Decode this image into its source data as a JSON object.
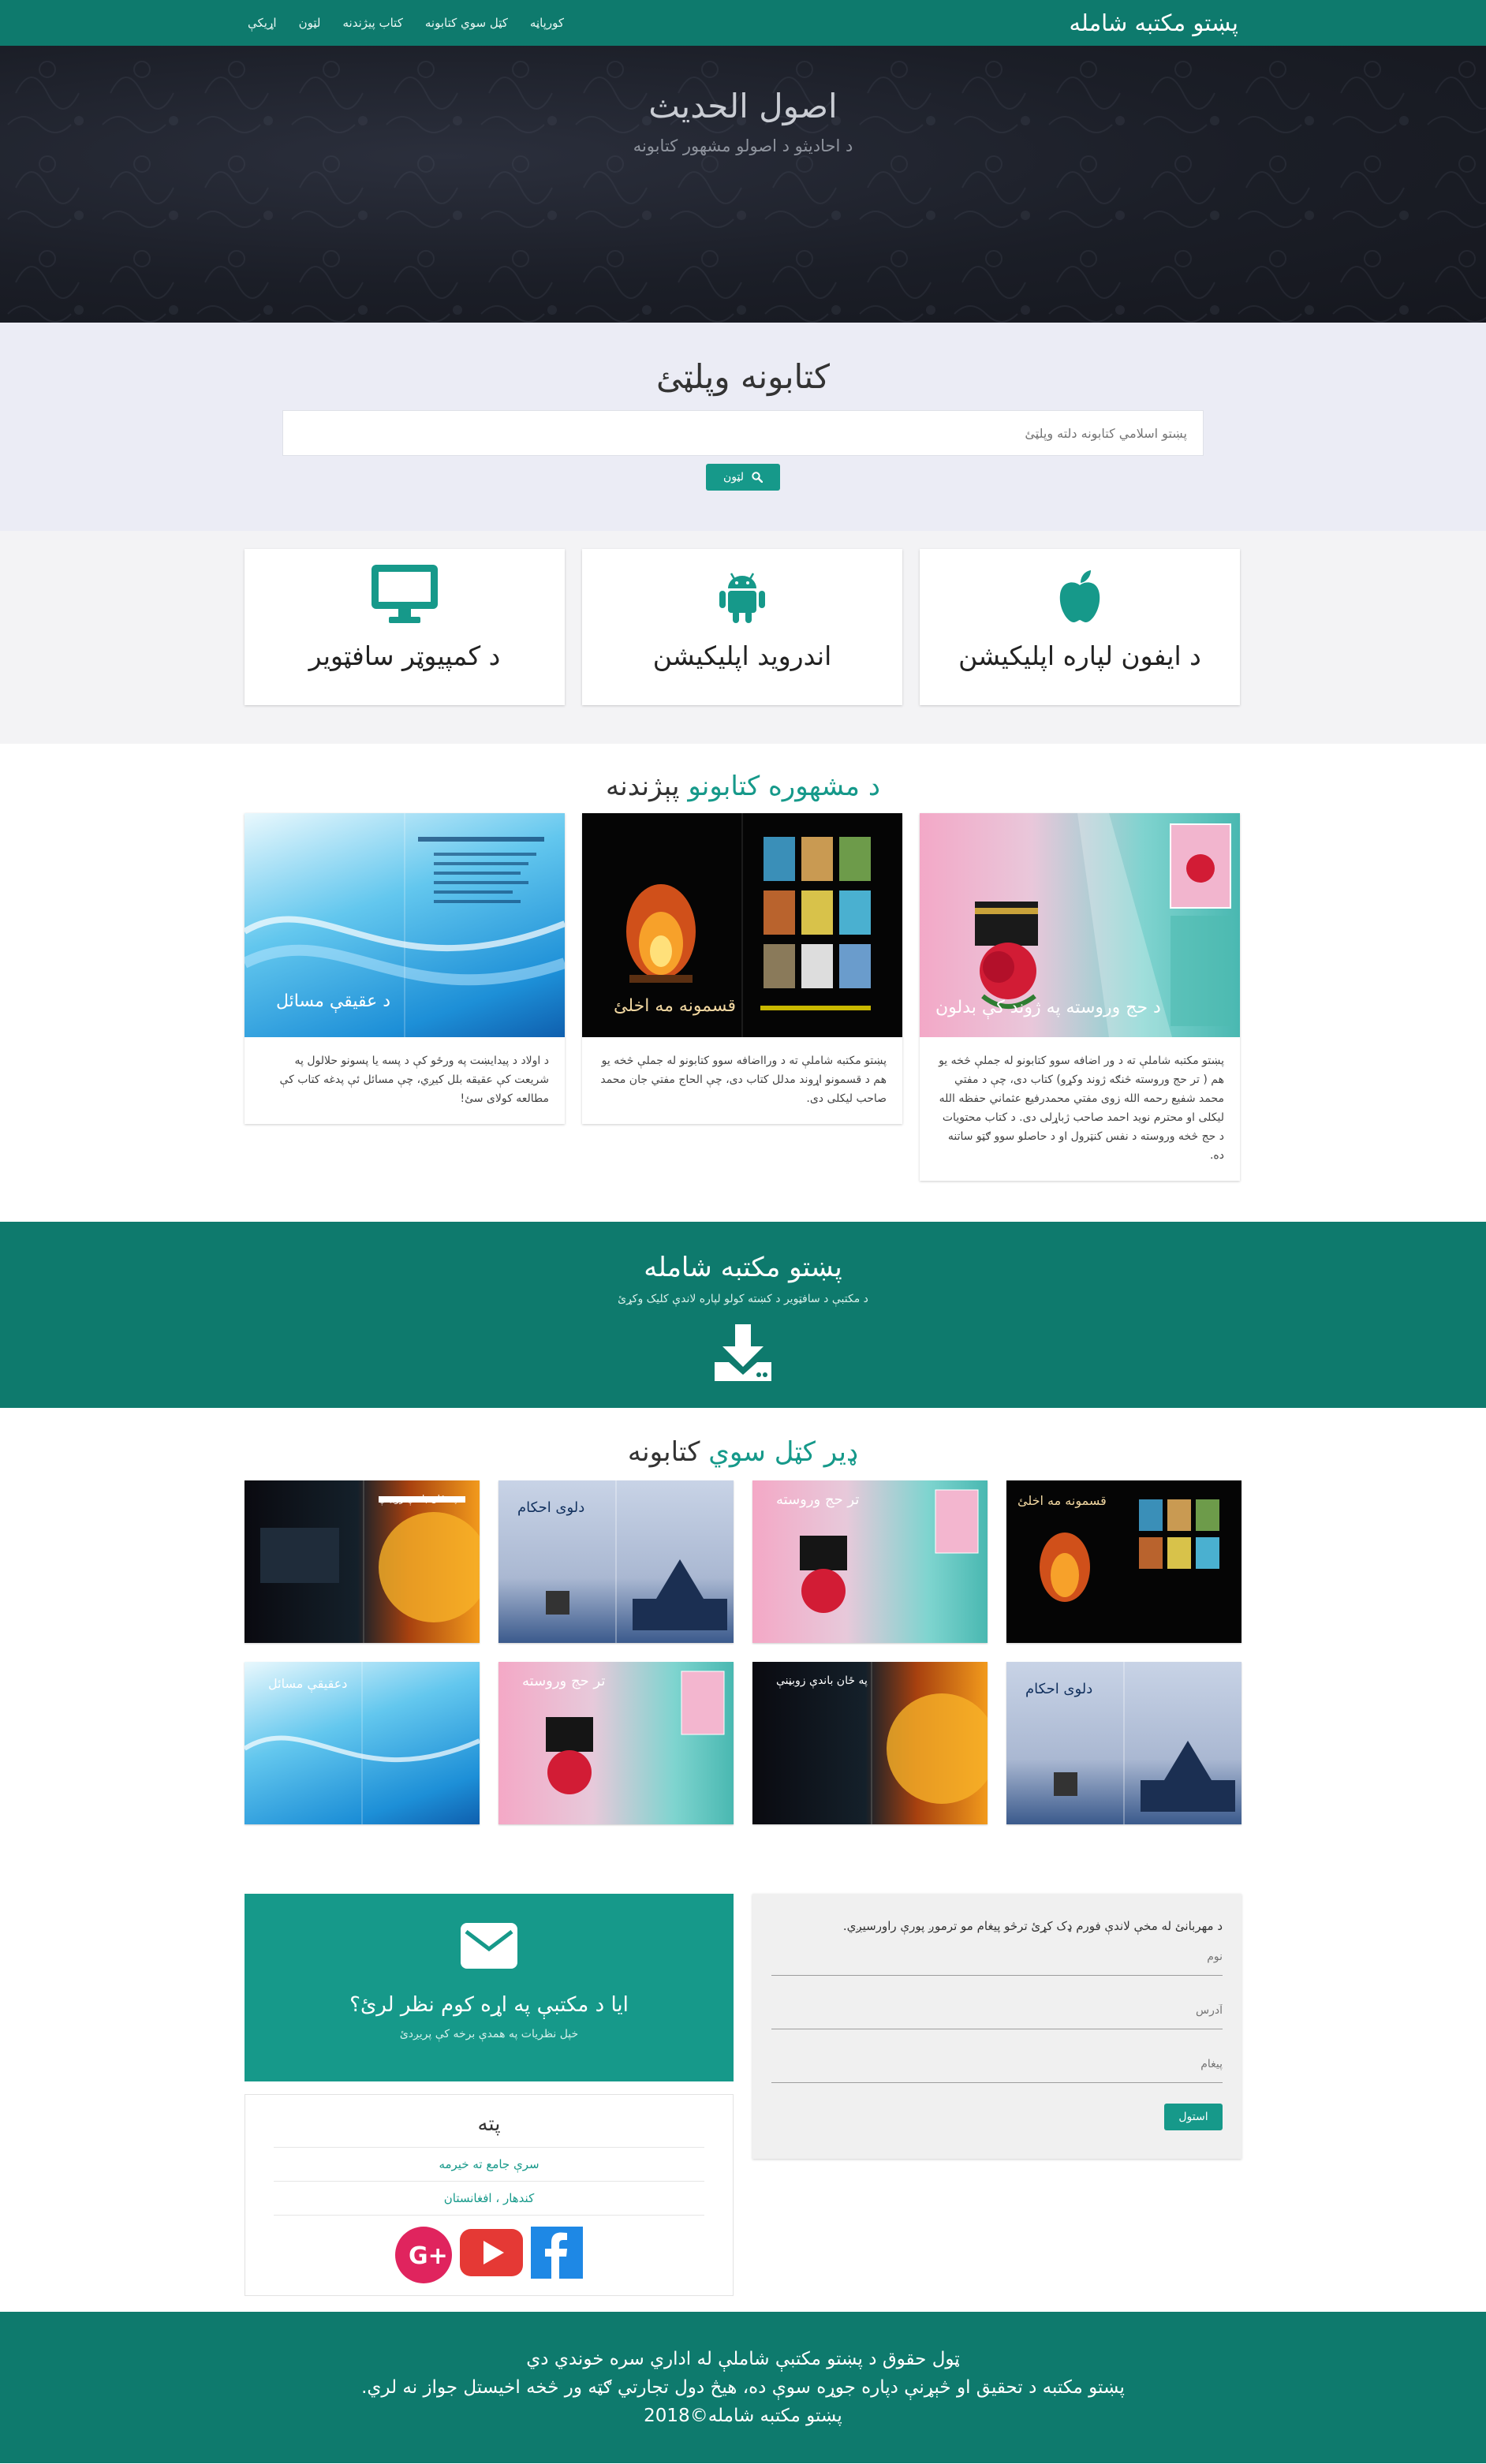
{
  "navbar": {
    "brand": "پښتو مکتبه شامله",
    "links": [
      "کورپاڼه",
      "کټل سوي کتابونه",
      "کتاب پیژندنه",
      "لټون",
      "اړیکې"
    ]
  },
  "hero": {
    "title": "اصول الحديث",
    "subtitle": "د احاديثو د اصولو مشهور کتابونه"
  },
  "search": {
    "title": "کتابونه وپلټئ",
    "placeholder": "پښتو اسلامي کتابونه دلته وپلټئ",
    "button_label": "لټون"
  },
  "apps": [
    {
      "label": "د ایفون لپاره اپلیکیشن",
      "icon": "apple-icon"
    },
    {
      "label": "اندروید اپلیکیشن",
      "icon": "android-icon"
    },
    {
      "label": "د کمپیوټر سافټویر",
      "icon": "desktop-icon"
    }
  ],
  "popular": {
    "title_plain": "پېژندنه",
    "title_highlight": "د مشهوره کتابونو",
    "books": [
      {
        "cover_title": "د حج وروسته په ژوند کې بدلون",
        "description": "پښتو مکتبه شاملې ته د ور اضافه سوو کتابونو له جملې څخه یو هم ( تر حج وروسته څنګه ژوند وکړو) کتاب دی، چې د مفتي محمد شفيع رحمه الله زوی مفتي محمدرفيع عثماني حفظه الله ليکلی او محترم نوید احمد صاحب ژباړلی دی. د کتاب محتويات د حج څخه وروسته د نفس کنټرول او د حاصلو سوو ګټو ساتنه ده."
      },
      {
        "cover_title": "قسمونه مه اخلئ",
        "description": "پښتو مکتبه شاملې ته د ورااضافه سوو کتابونو له جملې څخه یو هم د قسمونو اړوند مدلل کتاب دی، چې الحاج مفتي جان محمد صاحب لیکلی دی."
      },
      {
        "cover_title": "د عقيقې مسائل",
        "description": "د اولاد د پيدايښت په ورځو کې د پسه يا پسونو حلالول په شريعت کې عقيقه بلل کيږي، چې مسائل ئې پدغه کتاب کې مطالعه کولای سئ!"
      }
    ]
  },
  "download": {
    "title": "پښتو مکتبه شامله",
    "subtitle": "د مکتبې د سافټویر د کښته کولو لپاره لاندې کلیک وکړئ"
  },
  "more": {
    "title_highlight": "ډیر کټل سوي",
    "title_plain": "کتابونه",
    "books": [
      {
        "label": "قسمونه مه اخلئ"
      },
      {
        "label": "تر حج وروسته"
      },
      {
        "label": "دلوی احکام"
      },
      {
        "label": "په ځان باندې زوبڼنې"
      },
      {
        "label": "دلوی احکام"
      },
      {
        "label": "په ځان باندې زوبڼنې"
      },
      {
        "label": "تر حج وروسته"
      },
      {
        "label": "دعقيقې مسائل"
      }
    ]
  },
  "feedback": {
    "title": "ایا د مکتبې په اړه کوم نظر لرئ؟",
    "subtitle": "خپل نظریات په همدې برخه کې پریږدئ"
  },
  "address": {
    "title": "پته",
    "lines": [
      "سرې جامع ته خیرمه",
      "کندهار ، افغانستان"
    ]
  },
  "contact_form": {
    "intro": "د مهربانئ له مخې لاندې فورم ډک کړئ ترڅو پیغام مو ترموږ پورې راورسیږي.",
    "name_placeholder": "نوم",
    "address_placeholder": "آدرس",
    "message_placeholder": "پیغام",
    "send_label": "استول"
  },
  "footer": {
    "line1": "ټول حقوق د پښتو مکتبې شاملې له اداري سره خوندي دي",
    "line2": "پښتو مکتبه د تحقيق او څېړنې دپاره جوړه سوې ده، هيڅ دول تجارتي ګټه ور څخه اخيستل جواز نه لري.",
    "line3": "پښتو مکتبه شامله©2018"
  }
}
